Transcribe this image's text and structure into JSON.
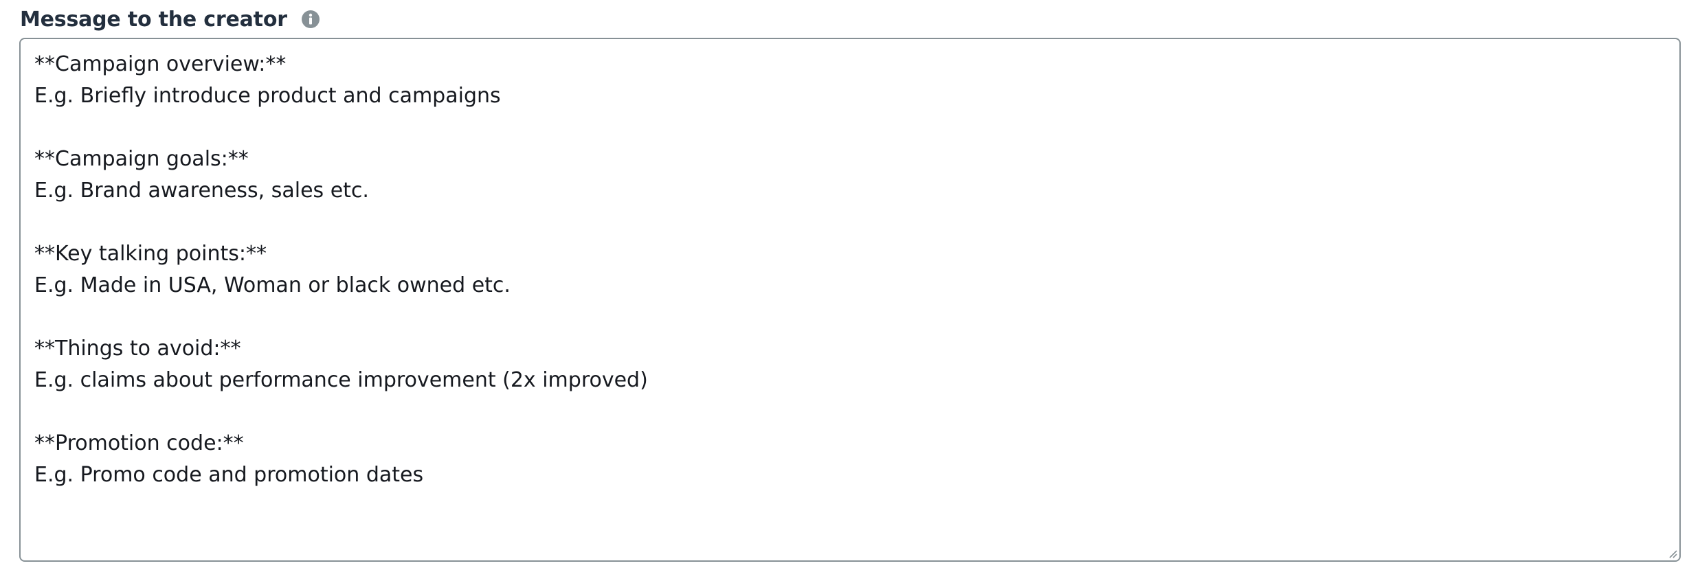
{
  "field": {
    "label": "Message to the creator",
    "info_icon": "info-icon",
    "value_lines": [
      "**Campaign overview:**",
      "E.g. Briefly introduce product and campaigns",
      "",
      "**Campaign goals:**",
      "E.g. Brand awareness, sales etc.",
      "",
      "**Key talking points:**",
      "E.g. Made in USA, Woman or black owned etc.",
      "",
      "**Things to avoid:**",
      "E.g. claims about performance improvement (2x improved)",
      "",
      "**Promotion code:**",
      "E.g. Promo code and promotion dates"
    ]
  },
  "colors": {
    "label": "#232f3e",
    "text": "#16191f",
    "border": "#879196",
    "info_icon": "#879196"
  }
}
